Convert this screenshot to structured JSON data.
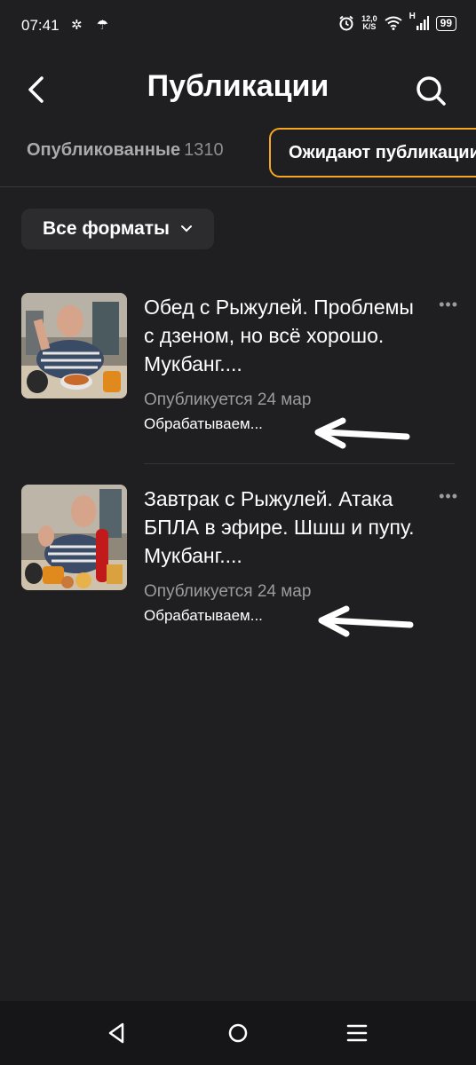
{
  "status_bar": {
    "time": "07:41",
    "left_icons": "✲ ☂",
    "speed_top": "12,0",
    "speed_bottom": "K/S",
    "network": "H",
    "battery": "99"
  },
  "header": {
    "title": "Публикации"
  },
  "tabs": [
    {
      "label": "Опубликованные",
      "count": "1310"
    },
    {
      "label": "Ожидают публикации"
    }
  ],
  "filter": {
    "label": "Все форматы"
  },
  "items": [
    {
      "title": "Обед с Рыжулей. Проблемы с дзеном, но всё хорошо. Мукбанг....",
      "date": "Опубликуется 24 мар",
      "status": "Обрабатываем..."
    },
    {
      "title": "Завтрак с Рыжулей. Атака БПЛА в эфире. Шшш и пупу. Мукбанг....",
      "date": "Опубликуется 24 мар",
      "status": "Обрабатываем..."
    }
  ],
  "icons": {
    "more": "•••"
  },
  "colors": {
    "background": "#1f1f21",
    "accent_tab_border": "#f5a623",
    "secondary_text": "#9b9ba0"
  }
}
